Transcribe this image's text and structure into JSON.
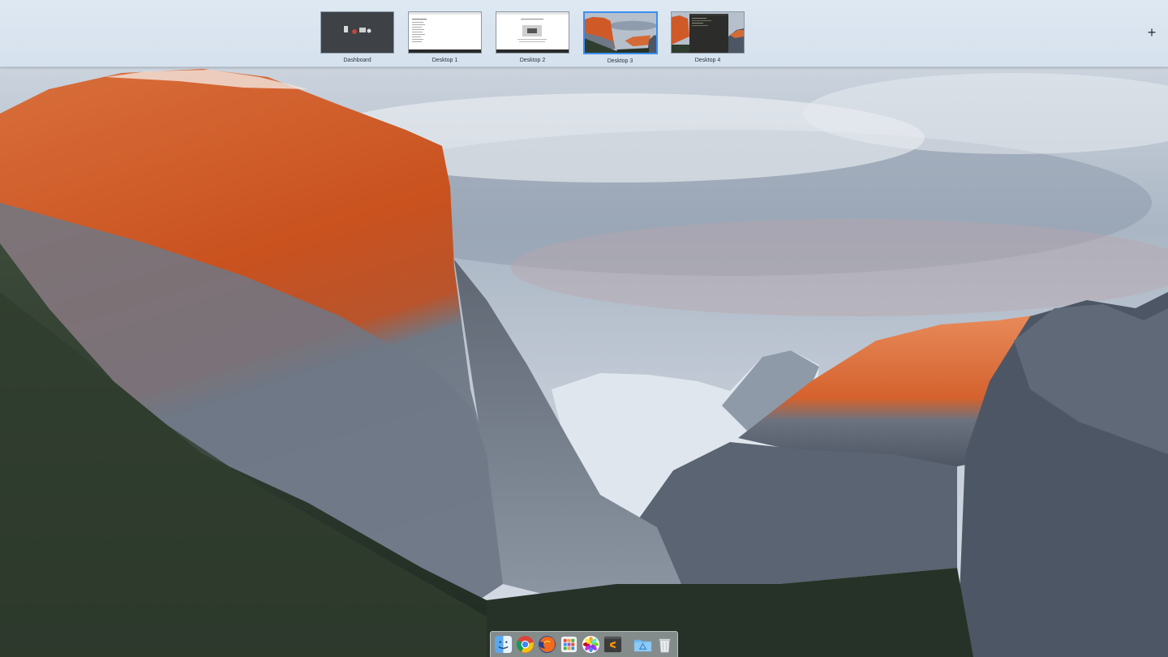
{
  "spaces_bar": {
    "spaces": [
      {
        "label": "Dashboard",
        "active": false
      },
      {
        "label": "Desktop 1",
        "active": false
      },
      {
        "label": "Desktop 2",
        "active": false
      },
      {
        "label": "Desktop 3",
        "active": true
      },
      {
        "label": "Desktop 4",
        "active": false
      }
    ],
    "add_symbol": "+",
    "accent": "#3b8ff0"
  },
  "dock": {
    "items": [
      "finder-icon",
      "chrome-icon",
      "firefox-icon",
      "launchpad-icon",
      "photos-icon",
      "sublime-text-icon",
      "applications-folder-icon",
      "trash-icon"
    ]
  }
}
